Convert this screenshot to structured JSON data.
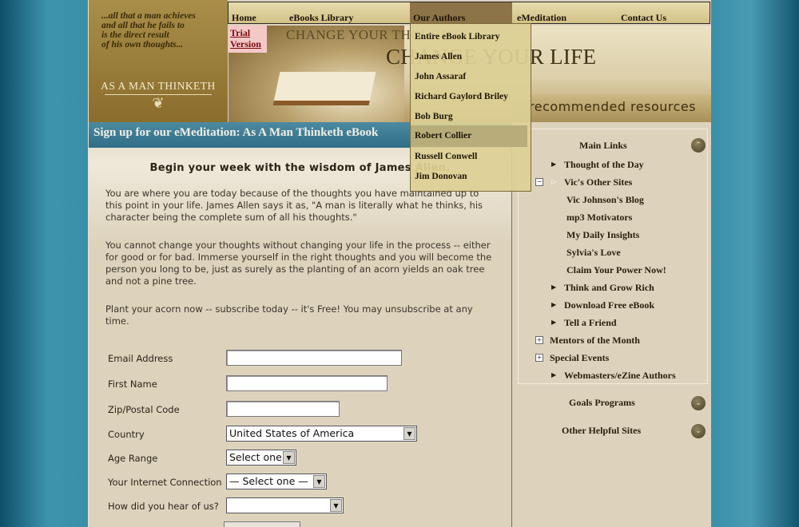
{
  "header": {
    "quote_lines": [
      "...all that a man achieves",
      "and all that he fails to",
      "is the direct result",
      "of his own thoughts..."
    ],
    "brand": "AS A MAN THINKETH",
    "trial_line1": "Trial",
    "trial_line2": "Version",
    "hero_title_small": "CHANGE YOUR THOUGHTS",
    "hero_title_large": "CHANGE YOUR LIFE",
    "resources": "recommended resources"
  },
  "nav": {
    "items": [
      {
        "label": "Home"
      },
      {
        "label": "eBooks Library"
      },
      {
        "label": "Our Authors"
      },
      {
        "label": "eMeditation"
      },
      {
        "label": "Contact Us"
      }
    ]
  },
  "authors_menu": [
    "Entire eBook Library",
    "James Allen",
    "John Assaraf",
    "Richard Gaylord Briley",
    "Bob Burg",
    "Robert Collier",
    "Russell Conwell",
    "Jim Donovan"
  ],
  "signup": {
    "title": "Sign up for our eMeditation: As A Man Thinketh eBook",
    "heading": "Begin your week with the wisdom of James Allen.",
    "para1": "You are where you are today because of the thoughts you have maintained up to this point in your life. James Allen says it as, \"A man is literally what he thinks, his character being the complete sum of all his thoughts.\"",
    "para2": "You cannot change your thoughts without changing your life in the process -- either for good or for bad. Immerse yourself in the right thoughts and you will become the person you long to be, just as surely as the planting of an acorn yields an oak tree and not a pine tree.",
    "para3": "Plant your acorn now -- subscribe today -- it's Free! You may unsubscribe at any time."
  },
  "form": {
    "email_label": "Email Address",
    "first_name_label": "First Name",
    "zip_label": "Zip/Postal Code",
    "country_label": "Country",
    "country_value": "United States of America",
    "age_label": "Age Range",
    "age_value": "Select one",
    "connection_label": "Your Internet Connection",
    "connection_value": "— Select one —",
    "heard_label": "How did you hear of us?",
    "heard_value": ""
  },
  "sidebar": {
    "main_links": "Main Links",
    "thought_of_day": "Thought of the Day",
    "vics_other_sites": "Vic's Other Sites",
    "vics_blog": "Vic Johnson's Blog",
    "mp3": "mp3 Motivators",
    "daily_insights": "My Daily Insights",
    "sylvias_love": "Sylvia's Love",
    "claim_power": "Claim Your Power Now!",
    "think_grow_rich": "Think and Grow Rich",
    "download_ebook": "Download Free eBook",
    "tell_friend": "Tell a Friend",
    "mentors": "Mentors of the Month",
    "special_events": "Special Events",
    "webmasters": "Webmasters/eZine Authors",
    "goals_programs": "Goals Programs",
    "other_sites": "Other Helpful Sites"
  }
}
